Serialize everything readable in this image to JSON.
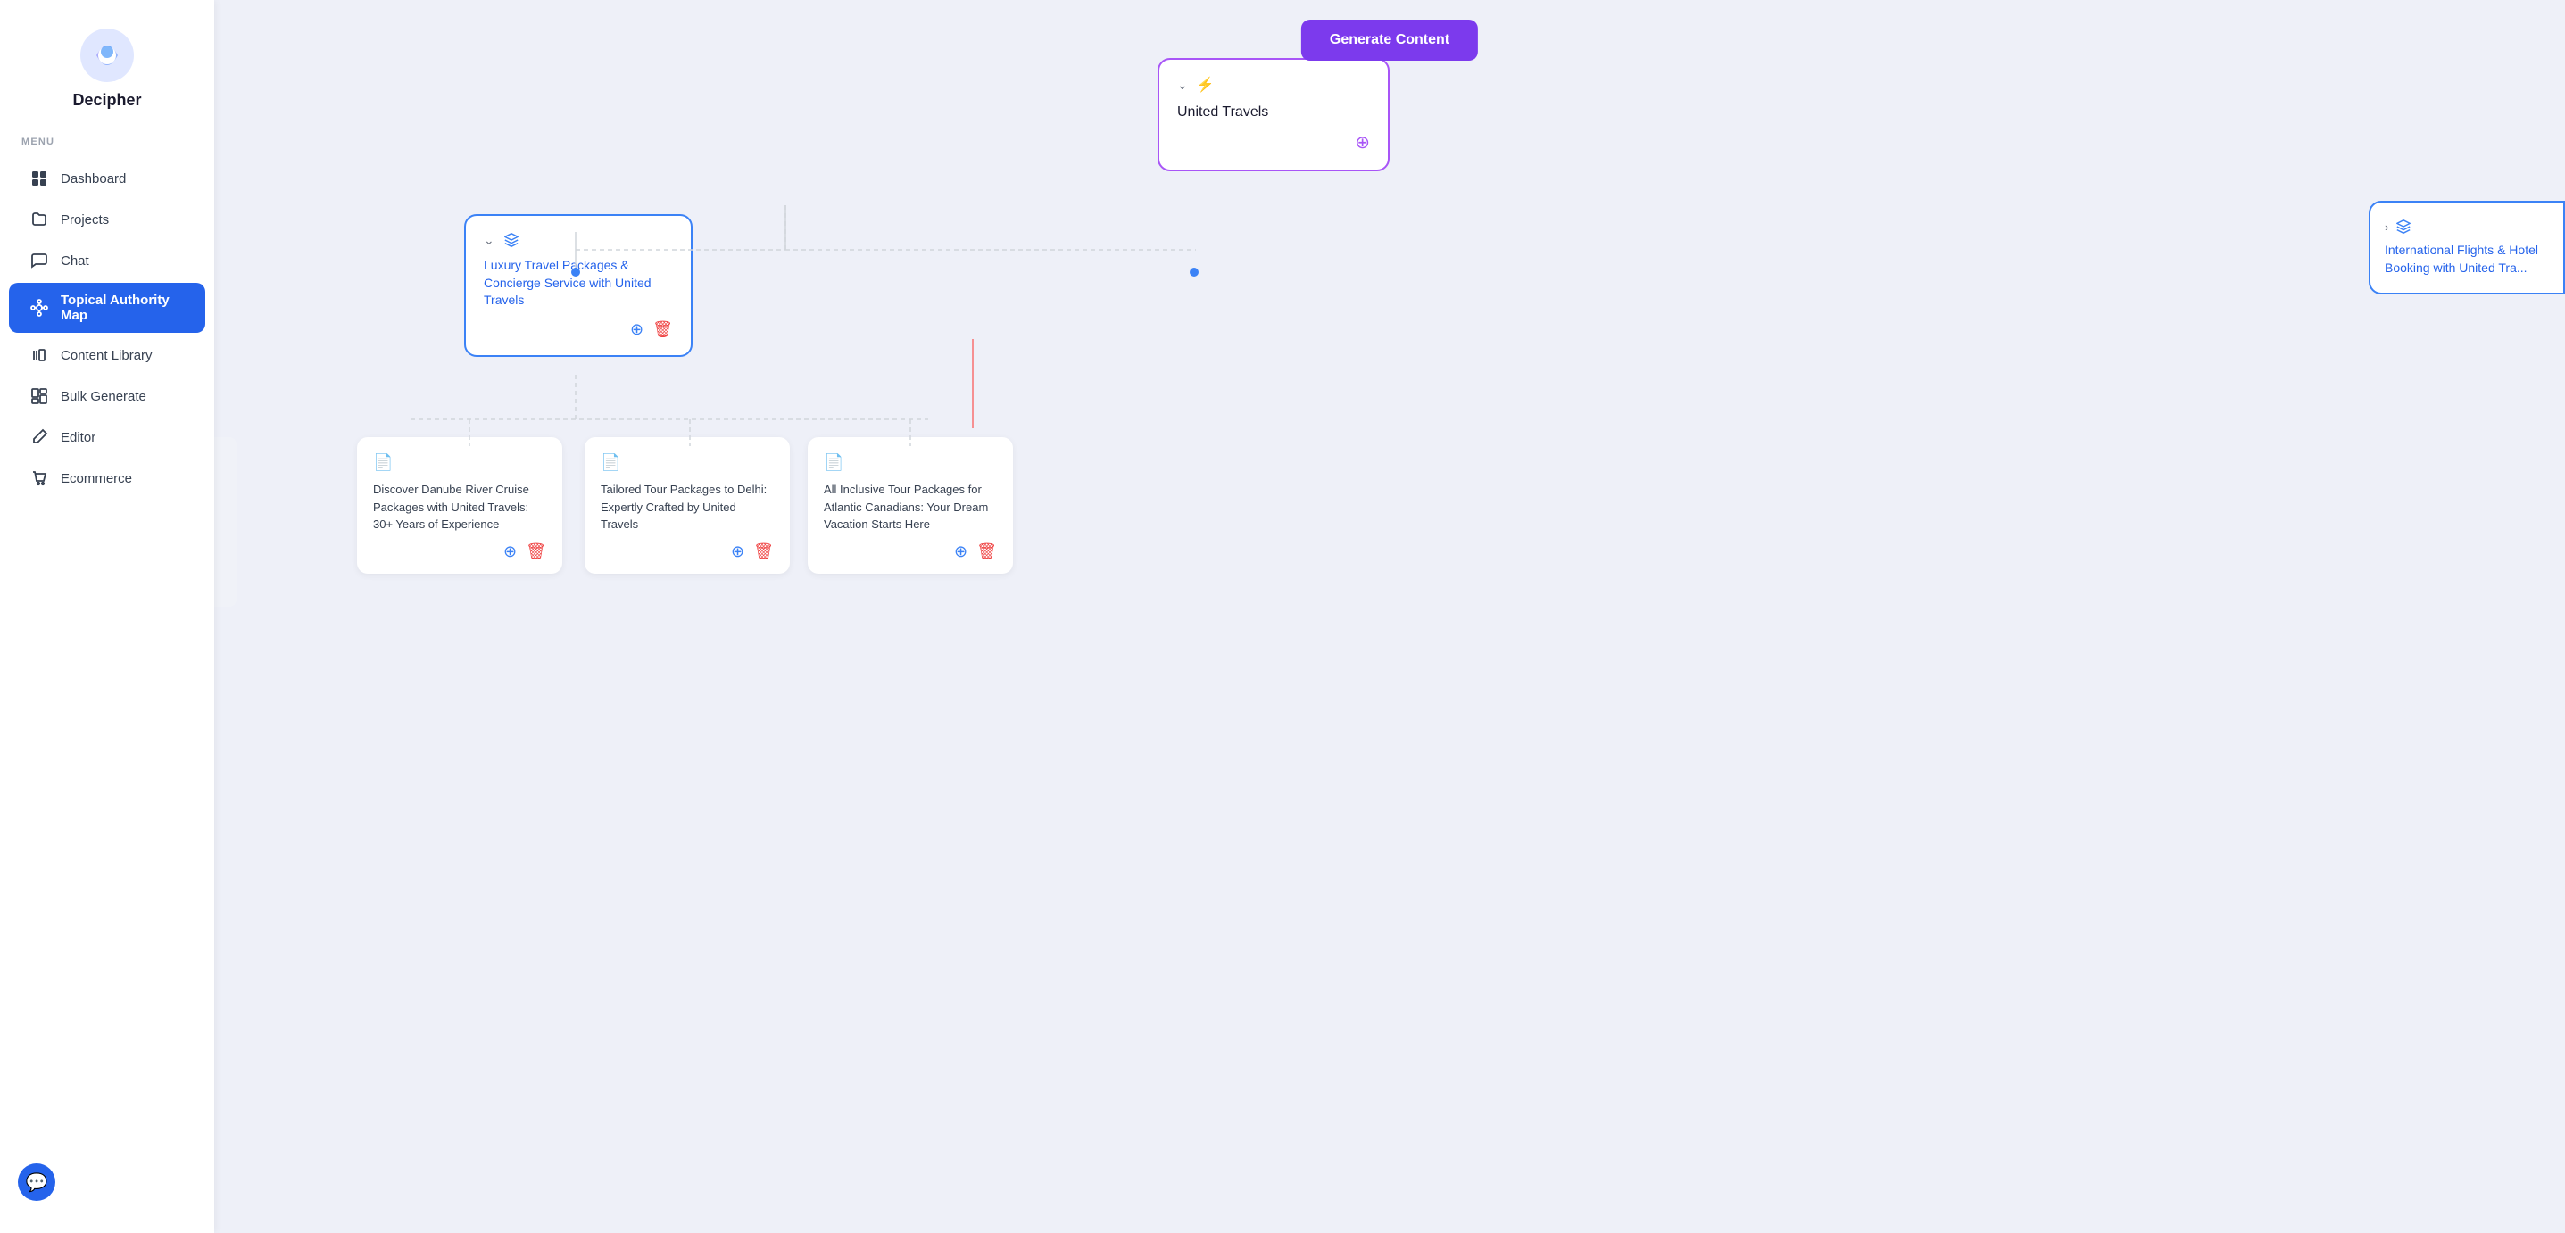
{
  "app": {
    "name": "Decipher"
  },
  "menu_label": "MENU",
  "nav_items": [
    {
      "id": "dashboard",
      "label": "Dashboard",
      "active": false
    },
    {
      "id": "projects",
      "label": "Projects",
      "active": false
    },
    {
      "id": "chat",
      "label": "Chat",
      "active": false
    },
    {
      "id": "topical-authority",
      "label": "Topical Authority Map",
      "active": true
    },
    {
      "id": "content-library",
      "label": "Content Library",
      "active": false
    },
    {
      "id": "bulk-generate",
      "label": "Bulk Generate",
      "active": false
    },
    {
      "id": "editor",
      "label": "Editor",
      "active": false
    },
    {
      "id": "ecommerce",
      "label": "Ecommerce",
      "active": false
    }
  ],
  "generate_btn": "Generate Content",
  "root_node": {
    "title": "United Travels",
    "add_tooltip": "Add"
  },
  "mid_node_left": {
    "title": "Luxury Travel Packages & Concierge Service with United Travels"
  },
  "mid_node_right": {
    "title": "International Flights & Hotel Booking with United Tra..."
  },
  "leaf_cards": [
    {
      "title": "Discover Danube River Cruise Packages with United Travels: 30+ Years of Experience"
    },
    {
      "title": "Tailored Tour Packages to Delhi: Expertly Crafted by United Travels"
    },
    {
      "title": "All Inclusive Tour Packages for Atlantic Canadians: Your Dream Vacation Starts Here"
    }
  ]
}
